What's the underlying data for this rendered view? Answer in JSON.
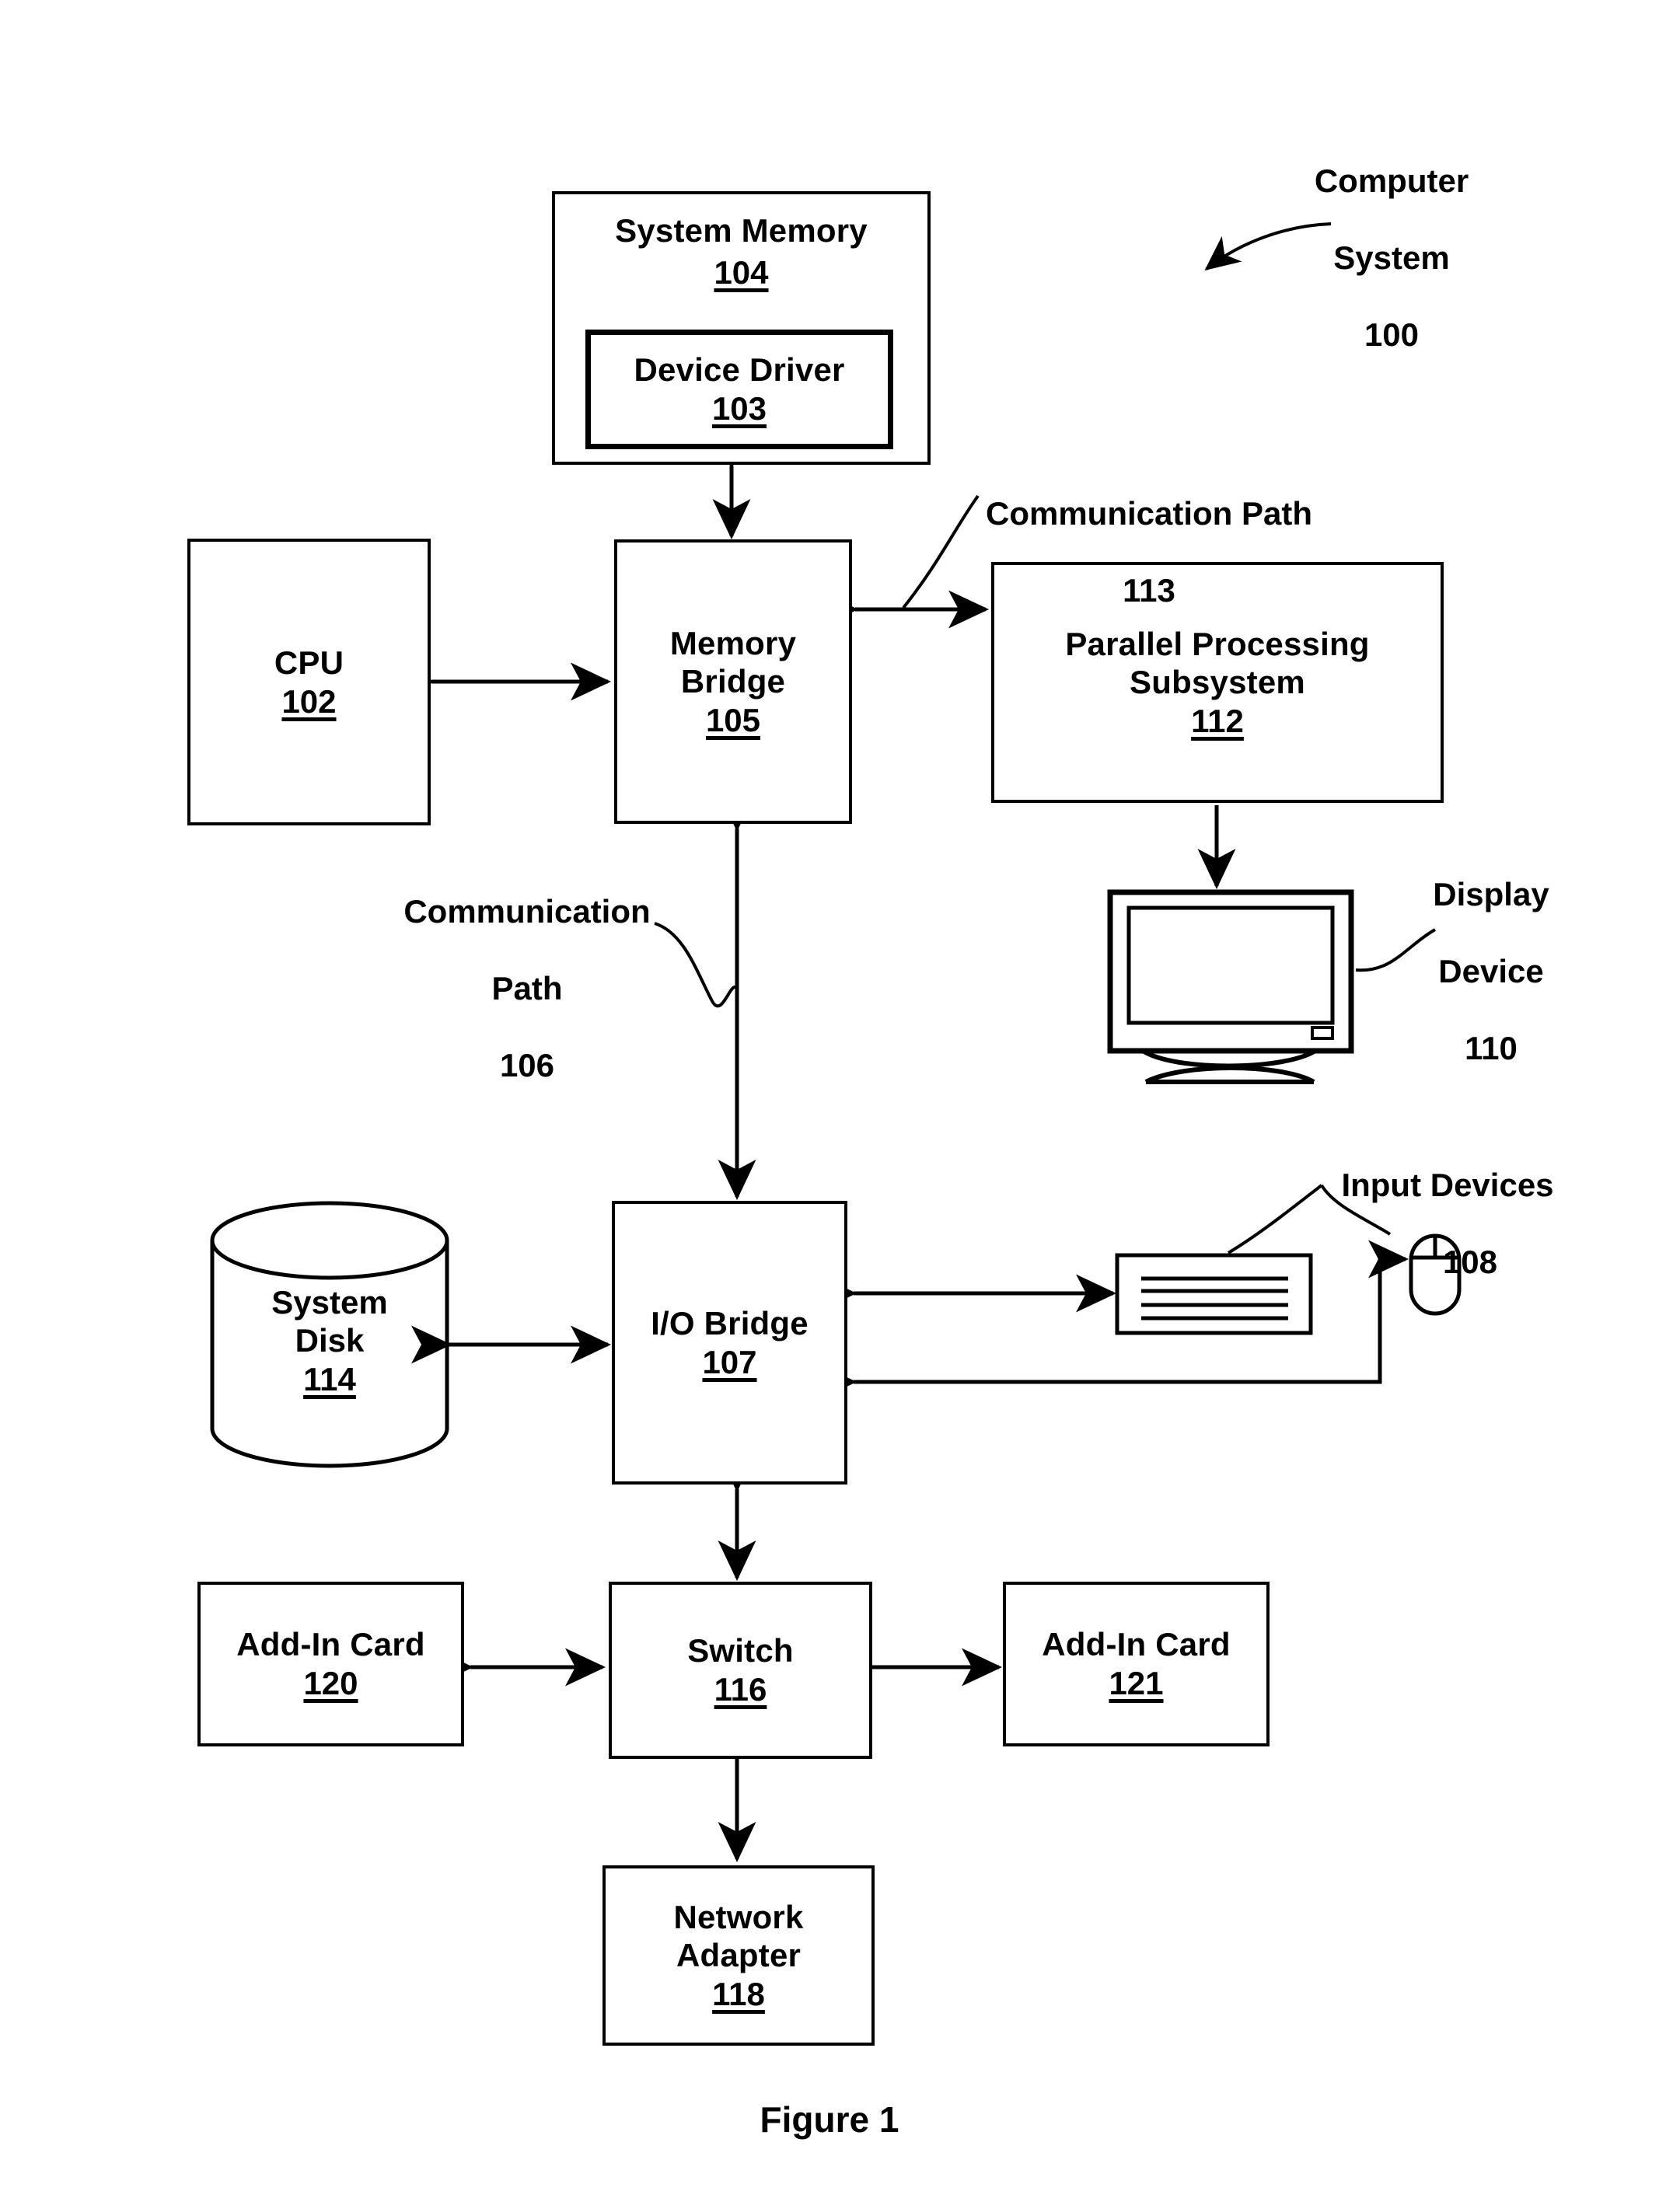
{
  "figure": {
    "caption": "Figure 1",
    "overall_label": {
      "title_line1": "Computer",
      "title_line2": "System",
      "number": "100"
    }
  },
  "blocks": [
    {
      "id": "system-memory",
      "title": "System Memory",
      "number": "104"
    },
    {
      "id": "device-driver",
      "title": "Device Driver",
      "number": "103"
    },
    {
      "id": "cpu",
      "title": "CPU",
      "number": "102"
    },
    {
      "id": "memory-bridge",
      "title_line1": "Memory",
      "title_line2": "Bridge",
      "number": "105"
    },
    {
      "id": "parallel-processing-subsystem",
      "title_line1": "Parallel Processing",
      "title_line2": "Subsystem",
      "number": "112"
    },
    {
      "id": "system-disk",
      "title_line1": "System",
      "title_line2": "Disk",
      "number": "114"
    },
    {
      "id": "io-bridge",
      "title": "I/O Bridge",
      "number": "107"
    },
    {
      "id": "add-in-card-120",
      "title": "Add-In Card",
      "number": "120"
    },
    {
      "id": "switch",
      "title": "Switch",
      "number": "116"
    },
    {
      "id": "add-in-card-121",
      "title": "Add-In Card",
      "number": "121"
    },
    {
      "id": "network-adapter",
      "title_line1": "Network",
      "title_line2": "Adapter",
      "number": "118"
    }
  ],
  "annotations": {
    "comm_path_113": {
      "text_line1": "Communication Path",
      "number": "113"
    },
    "comm_path_106": {
      "text_line1": "Communication",
      "text_line2": "Path",
      "number": "106"
    },
    "display_device": {
      "text_line1": "Display",
      "text_line2": "Device",
      "number": "110"
    },
    "input_devices": {
      "text_line1": "Input Devices",
      "number": "108"
    }
  },
  "colors": {
    "stroke": "#000000",
    "background": "#ffffff"
  }
}
